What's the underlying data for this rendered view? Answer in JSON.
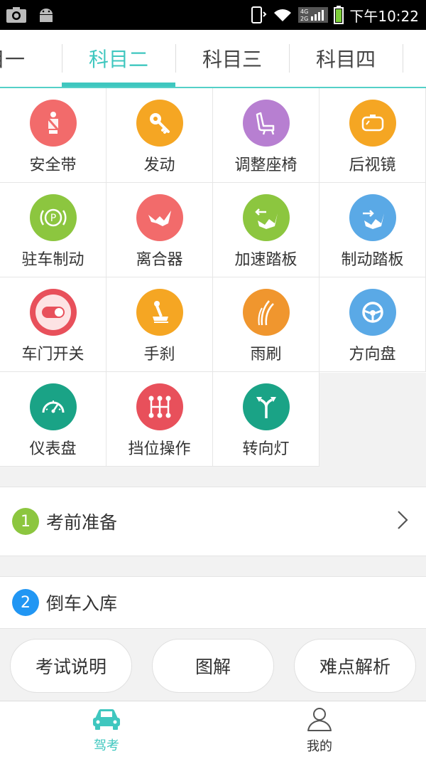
{
  "status_bar": {
    "time": "下午10:22",
    "network": "4G 2G",
    "icons": [
      "camera-icon",
      "android-icon",
      "phone-vibrate-icon",
      "wifi-icon",
      "signal-icon",
      "battery-icon"
    ]
  },
  "tabs": [
    {
      "label": "科目一",
      "visible_text": "目一",
      "active": false
    },
    {
      "label": "科目二",
      "active": true
    },
    {
      "label": "科目三",
      "active": false
    },
    {
      "label": "科目四",
      "active": false
    }
  ],
  "grid": [
    {
      "label": "安全带",
      "icon": "seatbelt-icon",
      "color": "#f26b6b"
    },
    {
      "label": "发动",
      "icon": "car-key-icon",
      "color": "#f5a623"
    },
    {
      "label": "调整座椅",
      "icon": "seat-icon",
      "color": "#b77fd1"
    },
    {
      "label": "后视镜",
      "icon": "mirror-icon",
      "color": "#f5a623"
    },
    {
      "label": "驻车制动",
      "icon": "parking-brake-icon",
      "color": "#8cc63f"
    },
    {
      "label": "离合器",
      "icon": "clutch-pedal-icon",
      "color": "#f26b6b"
    },
    {
      "label": "加速踏板",
      "icon": "accelerator-pedal-icon",
      "color": "#8cc63f"
    },
    {
      "label": "制动踏板",
      "icon": "brake-pedal-icon",
      "color": "#5aa9e6"
    },
    {
      "label": "车门开关",
      "icon": "door-switch-icon",
      "color": "#e8505b"
    },
    {
      "label": "手刹",
      "icon": "handbrake-icon",
      "color": "#f5a623"
    },
    {
      "label": "雨刷",
      "icon": "wiper-icon",
      "color": "#f0962e"
    },
    {
      "label": "方向盘",
      "icon": "steering-wheel-icon",
      "color": "#5aa9e6"
    },
    {
      "label": "仪表盘",
      "icon": "dashboard-icon",
      "color": "#1aa386"
    },
    {
      "label": "挡位操作",
      "icon": "gear-shift-icon",
      "color": "#e8505b"
    },
    {
      "label": "转向灯",
      "icon": "turn-signal-icon",
      "color": "#1aa386"
    }
  ],
  "sections": [
    {
      "number": "1",
      "title": "考前准备",
      "badge_color": "#8cc63f"
    },
    {
      "number": "2",
      "title": "倒车入库",
      "badge_color": "#2196f3"
    }
  ],
  "actions": [
    {
      "label": "考试说明"
    },
    {
      "label": "图解"
    },
    {
      "label": "难点解析"
    }
  ],
  "bottom_nav": [
    {
      "label": "驾考",
      "icon": "car-icon",
      "active": true
    },
    {
      "label": "我的",
      "icon": "user-icon",
      "active": false
    }
  ],
  "colors": {
    "accent": "#3fc7bf",
    "background": "#f2f2f2"
  }
}
